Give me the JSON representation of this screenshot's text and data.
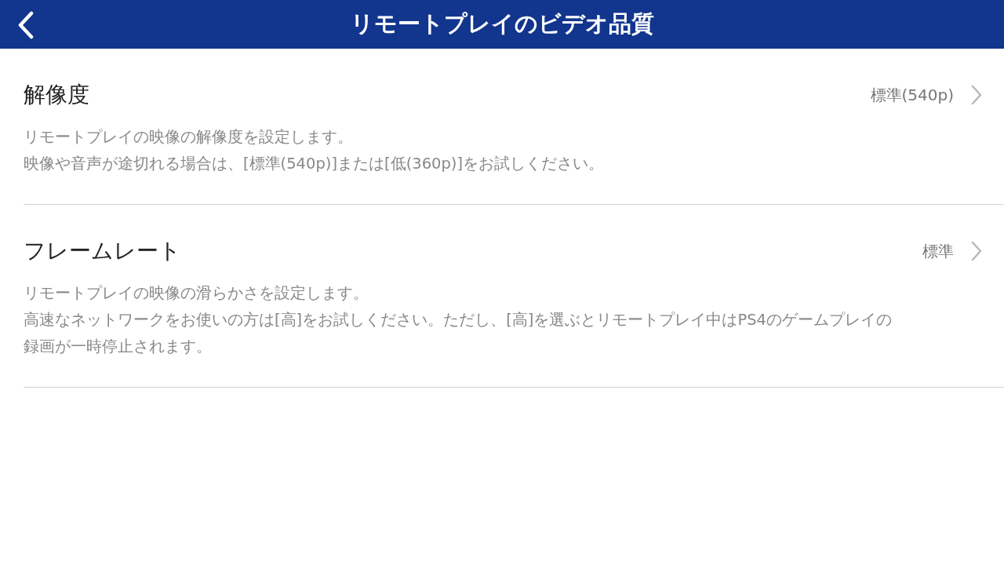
{
  "header": {
    "title": "リモートプレイのビデオ品質"
  },
  "settings": [
    {
      "label": "解像度",
      "value": "標準(540p)",
      "description_lines": [
        "リモートプレイの映像の解像度を設定します。",
        "映像や音声が途切れる場合は、[標準(540p)]または[低(360p)]をお試しください。"
      ]
    },
    {
      "label": "フレームレート",
      "value": "標準",
      "description_lines": [
        "リモートプレイの映像の滑らかさを設定します。",
        "高速なネットワークをお使いの方は[高]をお試しください。ただし、[高]を選ぶとリモートプレイ中はPS4のゲームプレイの",
        "録画が一時停止されます。"
      ]
    }
  ]
}
